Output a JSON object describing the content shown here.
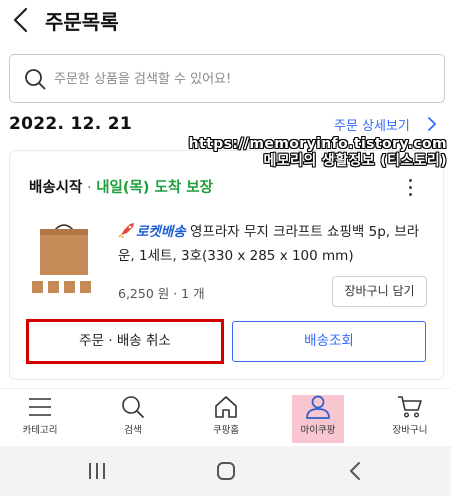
{
  "header": {
    "title": "주문목록"
  },
  "search": {
    "placeholder": "주문한 상품을 검색할 수 있어요!"
  },
  "order": {
    "date": "2022. 12. 21",
    "detail_link": "주문 상세보기",
    "status": "배송시작",
    "status_separator": " · ",
    "delivery_promise": "내일(목) 도착 보장",
    "product": {
      "badge": "로켓배송",
      "name": " 영프라자 무지 크라프트 쇼핑백 5p, 브라운, 1세트, 3호(330 x 285 x 100 mm)",
      "price_qty": "6,250 원 · 1 개"
    },
    "cart_button": "장바구니 담기",
    "cancel_button": "주문 · 배송 취소",
    "track_button": "배송조회"
  },
  "watermark": {
    "line1": "https://memoryinfo.tistory.com",
    "line2": "메모리의 생활정보 (티스토리)"
  },
  "bottom_nav": [
    {
      "label": "카테고리",
      "icon": "menu-icon"
    },
    {
      "label": "검색",
      "icon": "search-icon"
    },
    {
      "label": "쿠팡홈",
      "icon": "home-icon"
    },
    {
      "label": "마이쿠팡",
      "icon": "user-icon",
      "active": true
    },
    {
      "label": "장바구니",
      "icon": "cart-icon"
    }
  ],
  "colors": {
    "accent": "#346aff",
    "delivery_green": "#1f9d3a",
    "highlight_red": "#d40000",
    "active_nav_bg": "#f7c6d0"
  }
}
